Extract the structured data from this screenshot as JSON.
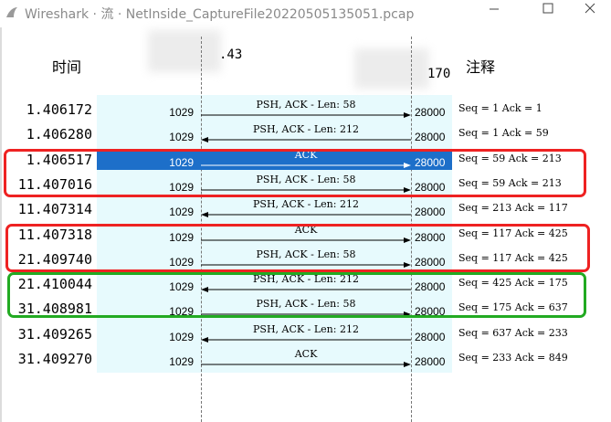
{
  "window": {
    "title": "Wireshark · 流 · NetInside_CaptureFile20220505135051.pcap",
    "controls": [
      "minimize-icon",
      "maximize-icon",
      "close-icon"
    ]
  },
  "header": {
    "time_label": "时间",
    "left_ip_fragment": ".43",
    "right_ip_fragment": "170",
    "note_label": "注释"
  },
  "rows": [
    {
      "time": "1.406172",
      "port_left": "1029",
      "label": "PSH, ACK - Len: 58",
      "port_right": "28000",
      "note": "Seq = 1 Ack = 1",
      "dir": "right",
      "selected": false
    },
    {
      "time": "1.406280",
      "port_left": "1029",
      "label": "PSH, ACK - Len: 212",
      "port_right": "28000",
      "note": "Seq = 1 Ack = 59",
      "dir": "left",
      "selected": false
    },
    {
      "time": "1.406517",
      "port_left": "1029",
      "label": "ACK",
      "port_right": "28000",
      "note": "Seq = 59 Ack = 213",
      "dir": "right",
      "selected": true
    },
    {
      "time": "11.407016",
      "port_left": "1029",
      "label": "PSH, ACK - Len: 58",
      "port_right": "28000",
      "note": "Seq = 59 Ack = 213",
      "dir": "right",
      "selected": false
    },
    {
      "time": "11.407314",
      "port_left": "1029",
      "label": "PSH, ACK - Len: 212",
      "port_right": "28000",
      "note": "Seq = 213 Ack = 117",
      "dir": "left",
      "selected": false
    },
    {
      "time": "11.407318",
      "port_left": "1029",
      "label": "ACK",
      "port_right": "28000",
      "note": "Seq = 117 Ack = 425",
      "dir": "right",
      "selected": false
    },
    {
      "time": "21.409740",
      "port_left": "1029",
      "label": "PSH, ACK - Len: 58",
      "port_right": "28000",
      "note": "Seq = 117 Ack = 425",
      "dir": "right",
      "selected": false
    },
    {
      "time": "21.410044",
      "port_left": "1029",
      "label": "PSH, ACK - Len: 212",
      "port_right": "28000",
      "note": "Seq = 425 Ack = 175",
      "dir": "left",
      "selected": false
    },
    {
      "time": "31.408981",
      "port_left": "1029",
      "label": "PSH, ACK - Len: 58",
      "port_right": "28000",
      "note": "Seq = 175 Ack = 637",
      "dir": "right",
      "selected": false
    },
    {
      "time": "31.409265",
      "port_left": "1029",
      "label": "PSH, ACK - Len: 212",
      "port_right": "28000",
      "note": "Seq = 637 Ack = 233",
      "dir": "left",
      "selected": false
    },
    {
      "time": "31.409270",
      "port_left": "1029",
      "label": "ACK",
      "port_right": "28000",
      "note": "Seq = 233 Ack = 849",
      "dir": "right",
      "selected": false
    }
  ],
  "colors": {
    "selection": "#1d6fc9",
    "flow_background": "#e7fafd",
    "highlight_red": "#ee2222",
    "highlight_green": "#22aa22"
  }
}
